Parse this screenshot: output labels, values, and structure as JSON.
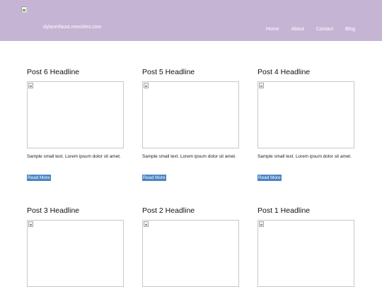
{
  "header": {
    "site_name": "dylanmfaust.neocities.com",
    "nav": [
      {
        "label": "Home"
      },
      {
        "label": "About"
      },
      {
        "label": "Contact"
      },
      {
        "label": "Blog"
      }
    ]
  },
  "posts": [
    {
      "headline": "Post 6 Headline",
      "excerpt": "Sample small text. Lorem ipsum dolor sit amet.",
      "button": "Read More"
    },
    {
      "headline": "Post 5 Headline",
      "excerpt": "Sample small text. Lorem ipsum dolor sit amet.",
      "button": "Read More"
    },
    {
      "headline": "Post 4 Headline",
      "excerpt": "Sample small text. Lorem ipsum dolor sit amet.",
      "button": "Read More"
    },
    {
      "headline": "Post 3 Headline"
    },
    {
      "headline": "Post 2 Headline"
    },
    {
      "headline": "Post 1 Headline"
    }
  ],
  "colors": {
    "header_bg": "#c6b4d4",
    "button_bg": "#4a84c4"
  }
}
